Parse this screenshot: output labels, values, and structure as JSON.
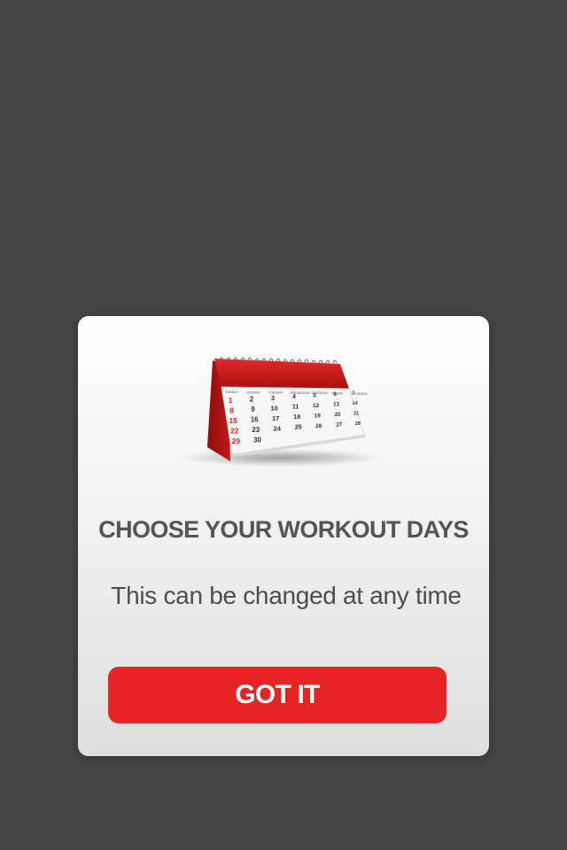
{
  "colors": {
    "backdrop": "#444444",
    "accent_red": "#e62424",
    "title_text": "#555555",
    "subtitle_text": "#4d4d4d",
    "button_text": "#ffffff"
  },
  "dialog": {
    "title": "CHOOSE YOUR WORKOUT DAYS",
    "subtitle": "This can be changed at any time",
    "button_label": "GOT IT",
    "illustration": {
      "icon": "calendar-icon",
      "day_headers": [
        "SUNDAY",
        "MONDAY",
        "TUESDAY",
        "WEDNESDAY",
        "THURSDAY",
        "FRIDAY",
        "SATURDAY"
      ],
      "weeks": [
        [
          "1",
          "2",
          "3",
          "4",
          "5",
          "6",
          "7"
        ],
        [
          "8",
          "9",
          "10",
          "11",
          "12",
          "13",
          "14"
        ],
        [
          "15",
          "16",
          "17",
          "18",
          "19",
          "20",
          "21"
        ],
        [
          "22",
          "23",
          "24",
          "25",
          "26",
          "27",
          "28"
        ],
        [
          "29",
          "30",
          "",
          "",
          "",
          "",
          ""
        ]
      ]
    }
  }
}
